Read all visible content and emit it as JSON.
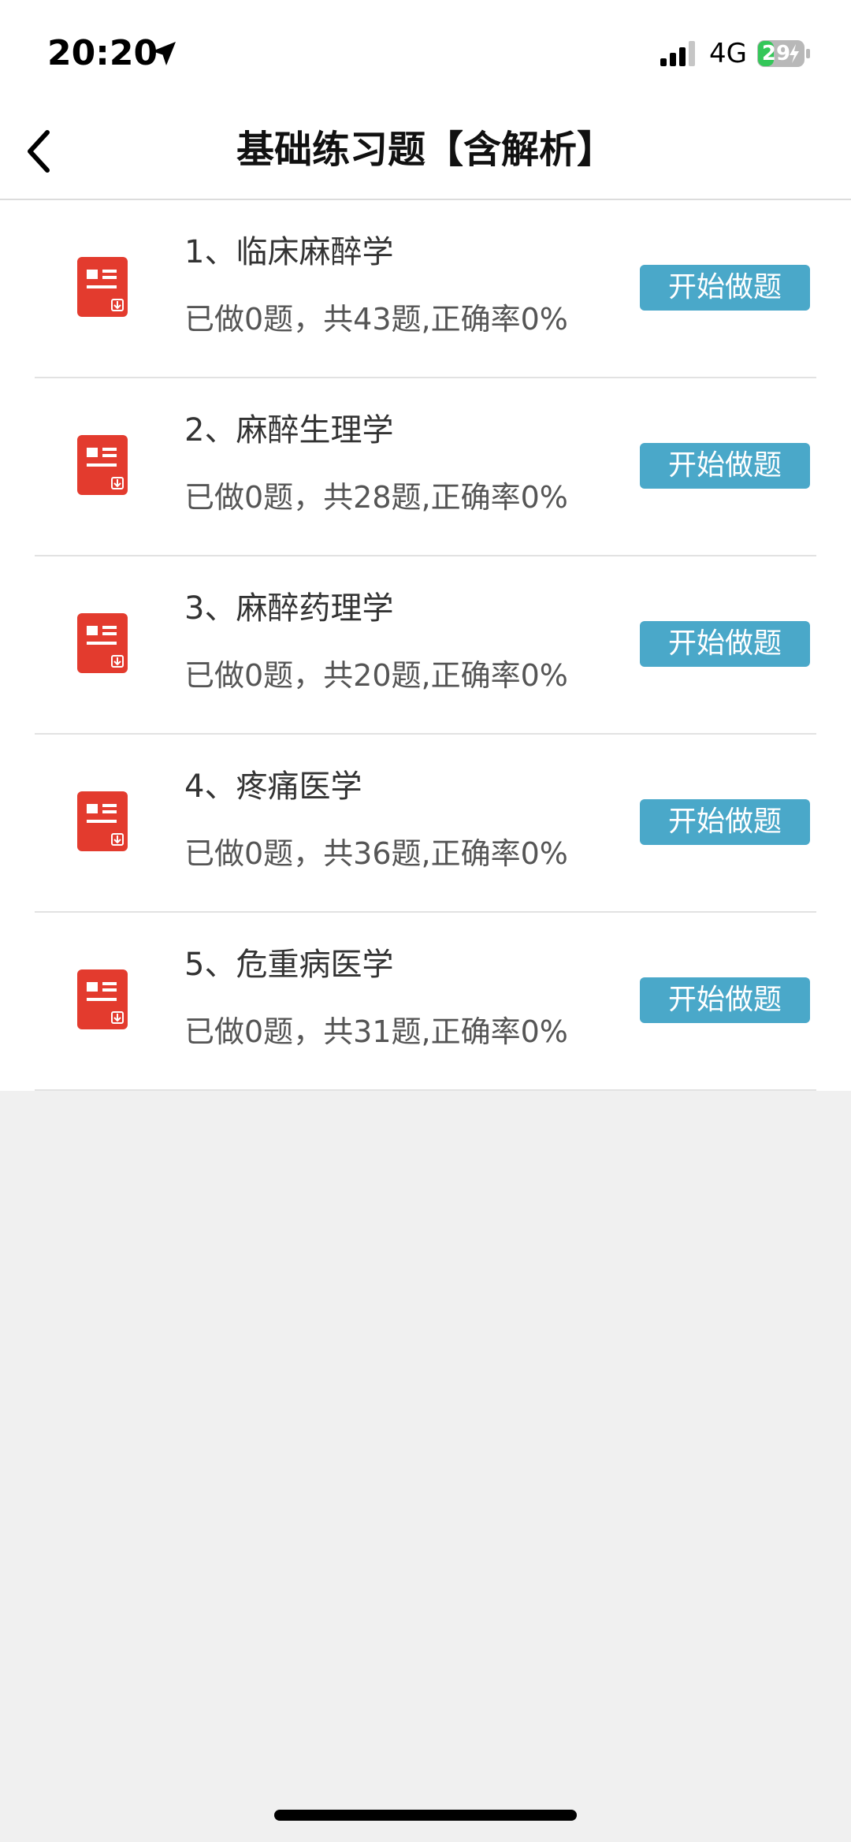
{
  "status_bar": {
    "time": "20:20",
    "network": "4G",
    "battery": "29"
  },
  "nav": {
    "title": "基础练习题【含解析】"
  },
  "colors": {
    "accent_button": "#4aa8c9",
    "icon_red": "#e33b2e"
  },
  "items": [
    {
      "title": "1、临床麻醉学",
      "stats": "已做0题，共43题,正确率0%",
      "button": "开始做题"
    },
    {
      "title": "2、麻醉生理学",
      "stats": "已做0题，共28题,正确率0%",
      "button": "开始做题"
    },
    {
      "title": "3、麻醉药理学",
      "stats": "已做0题，共20题,正确率0%",
      "button": "开始做题"
    },
    {
      "title": "4、疼痛医学",
      "stats": "已做0题，共36题,正确率0%",
      "button": "开始做题"
    },
    {
      "title": "5、危重病医学",
      "stats": "已做0题，共31题,正确率0%",
      "button": "开始做题"
    }
  ]
}
